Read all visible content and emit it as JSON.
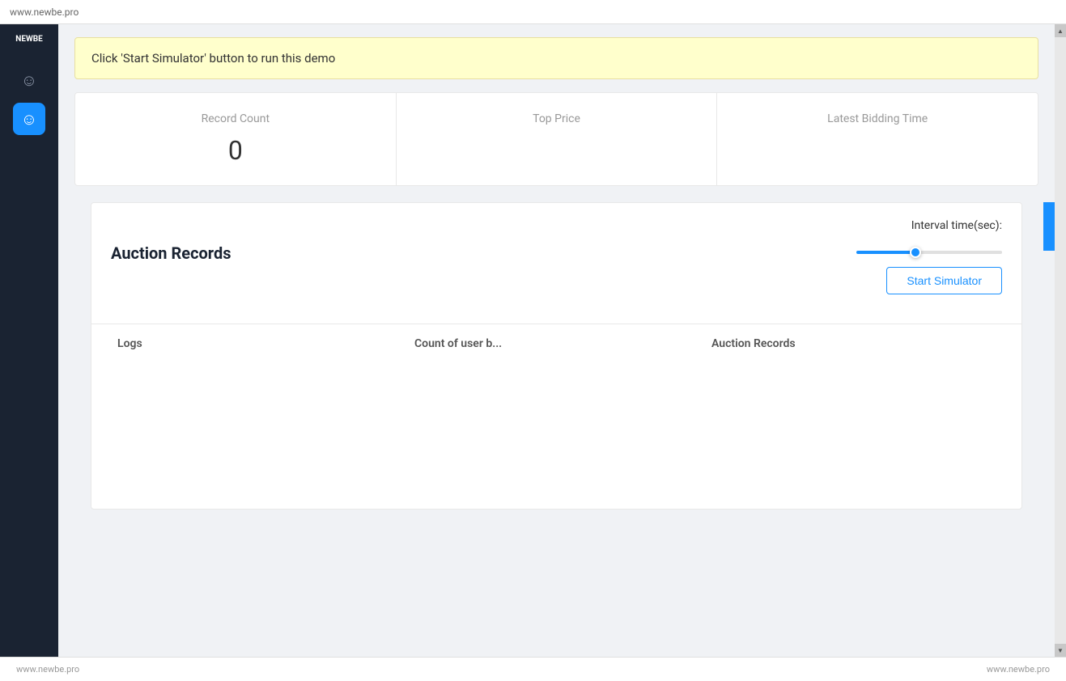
{
  "topbar": {
    "url": "www.newbe.pro"
  },
  "sidebar": {
    "brand": "NEWBE",
    "items": [
      {
        "id": "face-icon-1",
        "icon": "☺",
        "active": false
      },
      {
        "id": "face-icon-2",
        "icon": "☺",
        "active": true
      }
    ]
  },
  "notification": {
    "message": "Click 'Start Simulator' button to run this demo"
  },
  "stats": [
    {
      "label": "Record Count",
      "value": "0"
    },
    {
      "label": "Top Price",
      "value": ""
    },
    {
      "label": "Latest Bidding Time",
      "value": ""
    }
  ],
  "mainPanel": {
    "title": "Auction Records",
    "intervalLabel": "Interval time(sec):",
    "startButtonLabel": "Start Simulator",
    "tableColumns": [
      "Logs",
      "Count of user b...",
      "Auction Records"
    ]
  },
  "footer": {
    "left": "www.newbe.pro",
    "right": "www.newbe.pro"
  }
}
